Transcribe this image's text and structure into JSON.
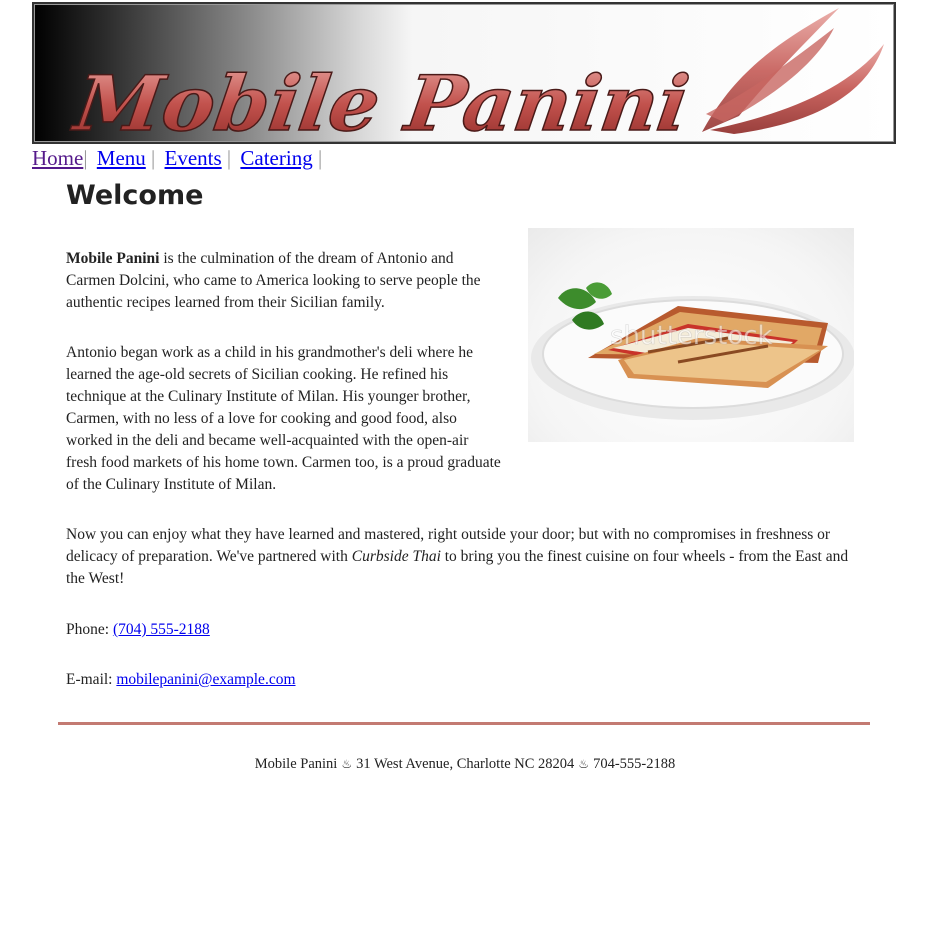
{
  "banner": {
    "logo_text": "Mobile Panini"
  },
  "nav": {
    "items": [
      {
        "label": "Home"
      },
      {
        "label": "Menu"
      },
      {
        "label": "Events"
      },
      {
        "label": "Catering"
      }
    ],
    "separator": "|"
  },
  "main": {
    "title": "Welcome",
    "p1": {
      "brand": "Mobile Panini",
      "text": " is the culmination of the dream of Antonio and Carmen Dolcini, who came to America looking to serve people the authentic recipes learned from their Sicilian family."
    },
    "p2": "Antonio began work as a child in his grandmother's deli where he learned the age-old secrets of Sicilian cooking. He refined his technique at the Culinary Institute of Milan. His younger brother, Carmen, with no less of a love for cooking and good food, also worked in the deli and became well-acquainted with the open-air fresh food markets of his home town. Carmen too, is a proud graduate of the Culinary Institute of Milan.",
    "p3": {
      "before": "Now you can enjoy what they have learned and mastered, right outside your door; but with no compromises in freshness or delicacy of preparation. We've partnered with ",
      "partner": "Curbside Thai",
      "after": " to bring you the finest cuisine on four wheels - from the East and the West!"
    },
    "phone": {
      "label": "Phone: ",
      "value": "(704) 555-2188"
    },
    "email": {
      "label": "E-mail: ",
      "value": "mobilepanini@example.com"
    },
    "photo": {
      "watermark": "shutterstock"
    }
  },
  "footer": {
    "name": "Mobile Panini",
    "address": "31 West Avenue, Charlotte NC 28204",
    "phone": "704-555-2188",
    "ornament": "♨"
  },
  "colors": {
    "logo_red": "#b8403d",
    "divider": "#c37a72",
    "link": "#0000ee",
    "visited": "#551a8b"
  }
}
